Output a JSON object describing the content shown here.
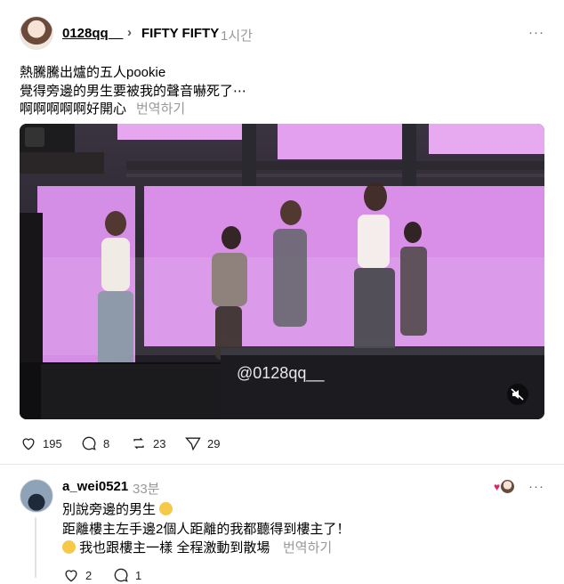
{
  "post": {
    "username": "0128qq__",
    "chevron": "›",
    "topic": "FIFTY FIFTY",
    "time": "1시간",
    "more": "···",
    "lines": [
      "熱騰騰出爐的五人pookie",
      "覺得旁邊的男生要被我的聲音嚇死了⋯",
      "啊啊啊啊啊好開心"
    ],
    "translate": "번역하기",
    "watermark": "@0128qq__",
    "stats": {
      "likes": "195",
      "comments": "8",
      "reposts": "23",
      "shares": "29"
    }
  },
  "reply": {
    "username": "a_wei0521",
    "time": "33분",
    "more": "···",
    "lines": [
      "別說旁邊的男生",
      "距離樓主左手邊2個人距離的我都聽得到樓主了！",
      "我也跟樓主一樣 全程激動到散場"
    ],
    "translate": "번역하기",
    "stats": {
      "likes": "2",
      "comments": "1"
    }
  },
  "colors": {
    "text": "#000000",
    "muted": "#999999",
    "stage_pink": "#d58ee6",
    "heart_red": "#e0245e"
  }
}
